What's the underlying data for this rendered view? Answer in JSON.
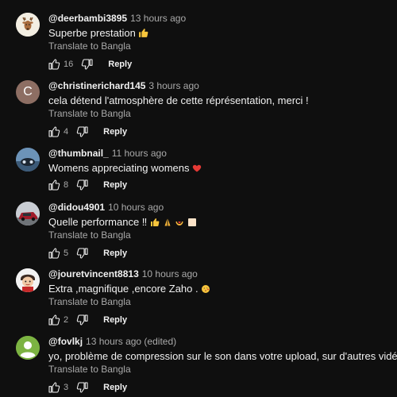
{
  "translate_label": "Translate to Bangla",
  "reply_label": "Reply",
  "comments": [
    {
      "user": "@deerbambi3895",
      "time": "13 hours ago",
      "text": "Superbe prestation",
      "likes": "16",
      "avatar": "deer-avatar"
    },
    {
      "user": "@christinerichard145",
      "time": "3 hours ago",
      "text": "cela détend l'atmosphère de cette réprésentation, merci !",
      "likes": "4",
      "avatar_letter": "C",
      "avatar_color": "#8d6e63"
    },
    {
      "user": "@thumbnail_",
      "time": "11 hours ago",
      "text": "Womens appreciating womens",
      "likes": "8",
      "avatar": "photo-avatar"
    },
    {
      "user": "@didou4901",
      "time": "10 hours ago",
      "text": "Quelle performance ‼",
      "likes": "5",
      "avatar": "car-avatar"
    },
    {
      "user": "@jouretvincent8813",
      "time": "10 hours ago",
      "text": "Extra ,magnifique ,encore Zaho .",
      "likes": "2",
      "avatar": "cartoon-avatar"
    },
    {
      "user": "@fovlkj",
      "time": "13 hours ago (edited)",
      "text": "yo, problème de compression sur le son dans votre upload, sur d'autres vidéos on entend bien mieux",
      "likes": "3",
      "avatar": "default-user-avatar",
      "avatar_color": "#7cb342"
    }
  ]
}
